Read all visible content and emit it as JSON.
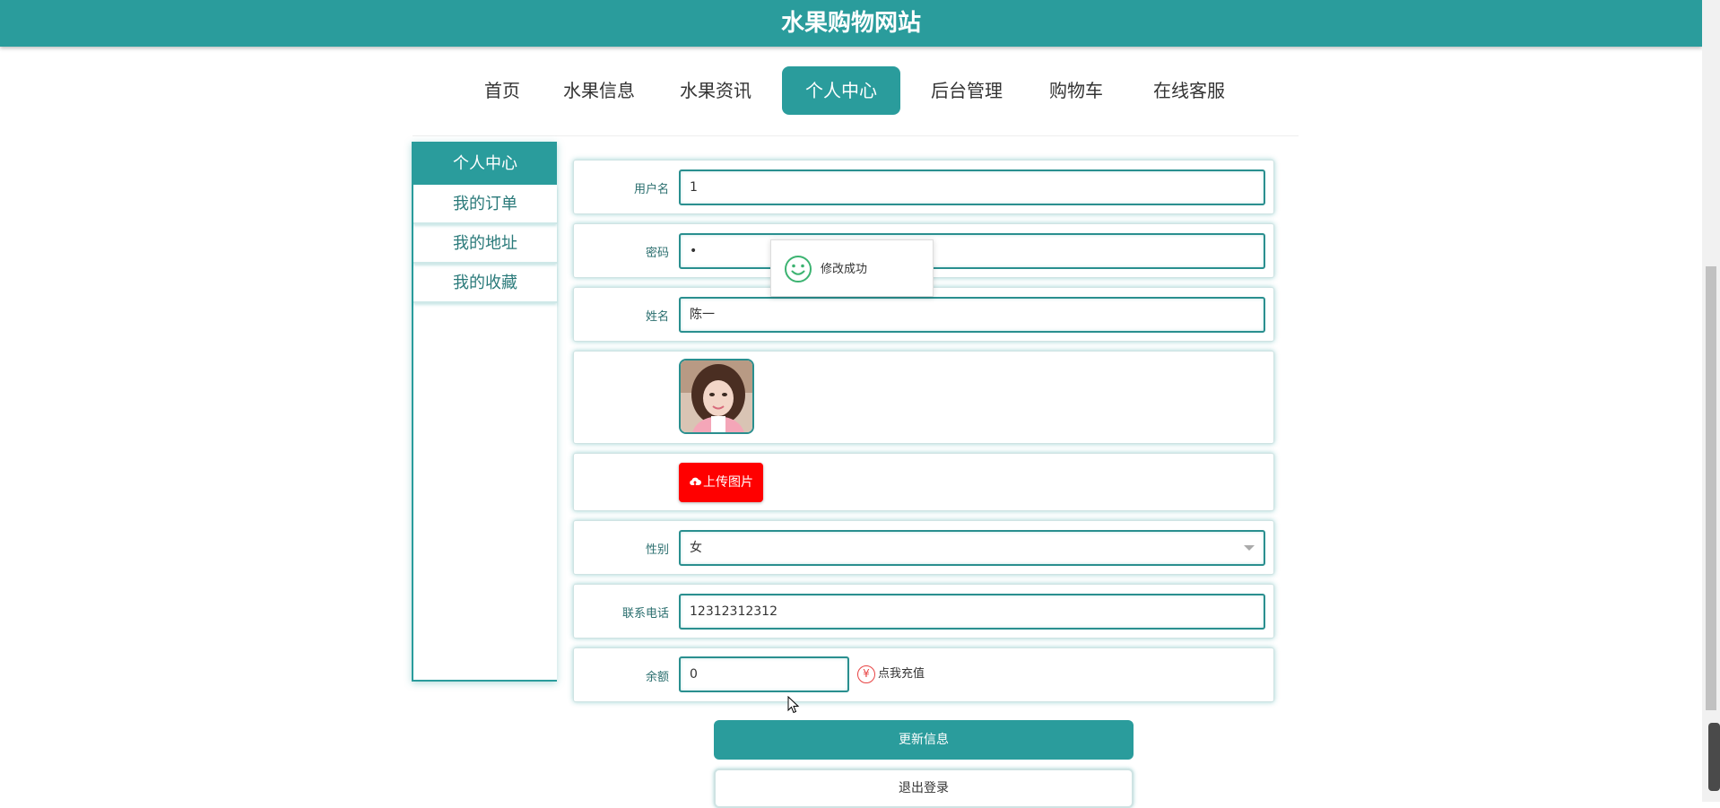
{
  "header": {
    "site_title": "水果购物网站"
  },
  "nav": {
    "items": [
      {
        "label": "首页",
        "active": false
      },
      {
        "label": "水果信息",
        "active": false
      },
      {
        "label": "水果资讯",
        "active": false
      },
      {
        "label": "个人中心",
        "active": true
      },
      {
        "label": "后台管理",
        "active": false
      },
      {
        "label": "购物车",
        "active": false
      },
      {
        "label": "在线客服",
        "active": false
      }
    ]
  },
  "sidebar": {
    "header": "个人中心",
    "items": [
      {
        "label": "我的订单"
      },
      {
        "label": "我的地址"
      },
      {
        "label": "我的收藏"
      }
    ]
  },
  "form": {
    "username": {
      "label": "用户名",
      "value": "1"
    },
    "password": {
      "label": "密码",
      "value": "•"
    },
    "name": {
      "label": "姓名",
      "value": "陈一"
    },
    "upload_label": "上传图片",
    "gender": {
      "label": "性别",
      "value": "女"
    },
    "phone": {
      "label": "联系电话",
      "value": "12312312312"
    },
    "balance": {
      "label": "余额",
      "value": "0",
      "recharge_label": "点我充值"
    }
  },
  "actions": {
    "update_label": "更新信息",
    "logout_label": "退出登录"
  },
  "toast": {
    "message": "修改成功"
  },
  "colors": {
    "primary": "#2a9c9c",
    "upload": "#ff0000",
    "recharge_icon": "#e84343",
    "toast_icon": "#3cb371"
  }
}
